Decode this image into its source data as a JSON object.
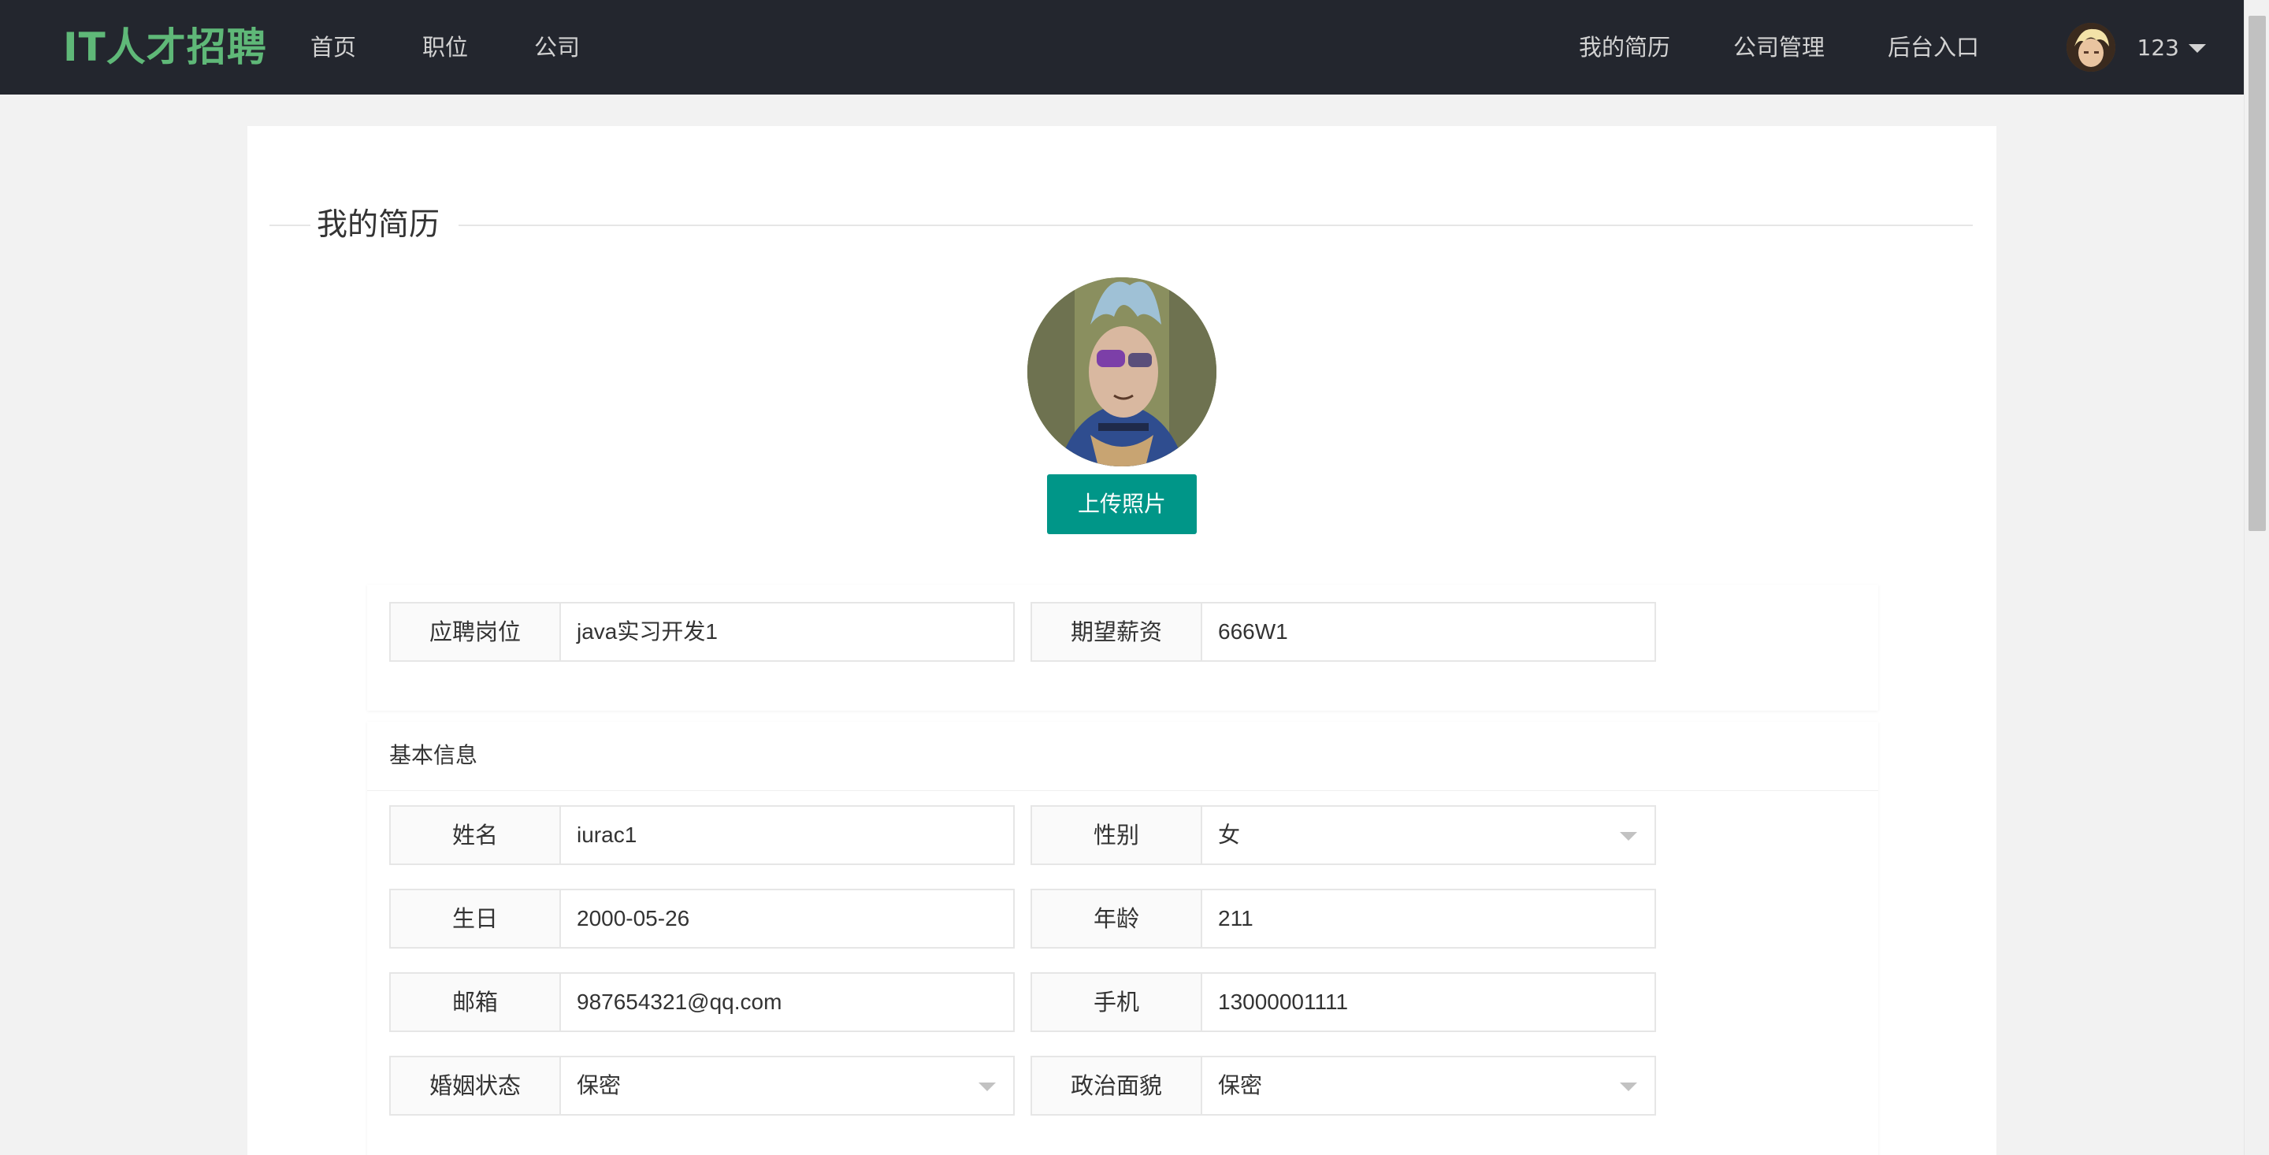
{
  "header": {
    "logo": "IT人才招聘",
    "nav_left": [
      "首页",
      "职位",
      "公司"
    ],
    "nav_right": [
      "我的简历",
      "公司管理",
      "后台入口"
    ],
    "username": "123"
  },
  "page": {
    "legend_title": "我的简历",
    "upload_button": "上传照片"
  },
  "job": {
    "position_label": "应聘岗位",
    "position_value": "java实习开发1",
    "salary_label": "期望薪资",
    "salary_value": "666W1"
  },
  "basic": {
    "title": "基本信息",
    "name_label": "姓名",
    "name_value": "iurac1",
    "gender_label": "性别",
    "gender_value": "女",
    "birthday_label": "生日",
    "birthday_value": "2000-05-26",
    "age_label": "年龄",
    "age_value": "211",
    "email_label": "邮箱",
    "email_value": "987654321@qq.com",
    "phone_label": "手机",
    "phone_value": "13000001111",
    "marital_label": "婚姻状态",
    "marital_value": "保密",
    "political_label": "政治面貌",
    "political_value": "保密"
  }
}
